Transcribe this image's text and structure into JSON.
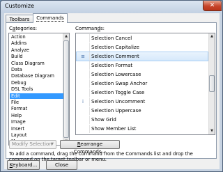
{
  "window": {
    "title": "Customize",
    "close_glyph": "✕"
  },
  "tabs": [
    {
      "label": "Toolbars",
      "active": false
    },
    {
      "label": "Commands",
      "active": true
    }
  ],
  "categories": {
    "label_pre": "C",
    "label_accel": "a",
    "label_post": "tegories:",
    "items": [
      "Action",
      "Addins",
      "Analyze",
      "Build",
      "Class Diagram",
      "Data",
      "Database Diagram",
      "Debug",
      "DSL Tools",
      "Edit",
      "File",
      "Format",
      "Help",
      "Image",
      "Insert",
      "Layout",
      "Macros"
    ],
    "selected": "Edit"
  },
  "commands": {
    "label_pre": "Comman",
    "label_accel": "d",
    "label_post": "s:",
    "items": [
      {
        "label": "Selection Cancel",
        "icon": "none"
      },
      {
        "label": "Selection Capitalize",
        "icon": "none"
      },
      {
        "label": "Selection Comment",
        "icon": "comment-lines-icon",
        "highlighted": true
      },
      {
        "label": "Selection Format",
        "icon": "none"
      },
      {
        "label": "Selection Lowercase",
        "icon": "none"
      },
      {
        "label": "Selection Swap Anchor",
        "icon": "none"
      },
      {
        "label": "Selection Toggle Case",
        "icon": "none"
      },
      {
        "label": "Selection Uncomment",
        "icon": "uncomment-lines-icon"
      },
      {
        "label": "Selection Uppercase",
        "icon": "none"
      },
      {
        "label": "Show Grid",
        "icon": "none"
      },
      {
        "label": "Show Member List",
        "icon": "none"
      }
    ]
  },
  "modify_selection": {
    "label": "Modify Selection",
    "arrow": "▼"
  },
  "rearrange": {
    "pre": "",
    "accel": "R",
    "post": "earrange Commands..."
  },
  "hint": "To add a command, drag the command from the Commands list and drop the command on the target toolbar or menu.",
  "footer": {
    "keyboard": {
      "accel": "K",
      "post": "eyboard..."
    },
    "close": "Close"
  },
  "colors": {
    "selection": "#3399ff",
    "title_close": "#c7452b"
  }
}
